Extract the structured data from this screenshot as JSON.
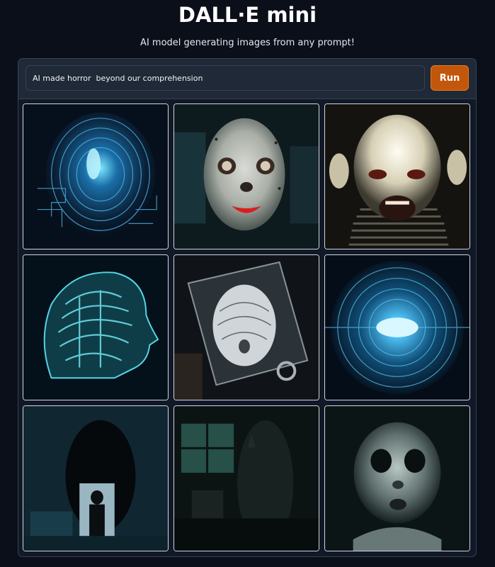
{
  "app": {
    "title": "DALL·E mini",
    "subtitle": "AI model generating images from any prompt!"
  },
  "prompt": {
    "value": "AI made horror  beyond our comprehension",
    "placeholder": ""
  },
  "run_button": {
    "label": "Run"
  },
  "gallery": {
    "images": [
      {
        "depicts": "blue circuit head"
      },
      {
        "depicts": "pale doll face"
      },
      {
        "depicts": "screaming pale face"
      },
      {
        "depicts": "glowing brain head"
      },
      {
        "depicts": "skull on screen"
      },
      {
        "depicts": "glowing blue orb"
      },
      {
        "depicts": "shadow figure in doorway"
      },
      {
        "depicts": "dark room window"
      },
      {
        "depicts": "ghostly child face"
      }
    ]
  },
  "colors": {
    "page_background": "#0b0f19",
    "panel_background": "#1f2937",
    "accent": "#c2570c"
  }
}
